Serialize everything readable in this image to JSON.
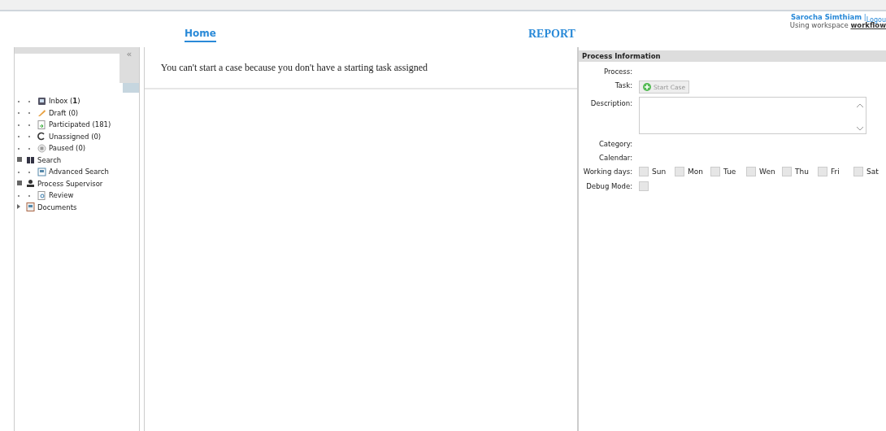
{
  "nav": {
    "tabs": [
      {
        "label": "Home",
        "selected": true
      },
      {
        "label": "REPORT",
        "selected": false
      }
    ]
  },
  "user": {
    "name": "Sarocha Simthiam",
    "separator": "|",
    "logout": "Logou",
    "workspace_label": "Using workspace",
    "workspace": "workflow"
  },
  "sidebar": {
    "collapse": "«",
    "tree": [
      {
        "label": "Inbox (**1**)"
      },
      {
        "label": "Draft (0)"
      },
      {
        "label": "Participated (181)"
      },
      {
        "label": "Unassigned (0)"
      },
      {
        "label": "Paused (0)"
      },
      {
        "label": "Search",
        "expanded": true,
        "children": [
          {
            "label": "Advanced Search"
          }
        ]
      },
      {
        "label": "Process Supervisor",
        "expanded": true,
        "children": [
          {
            "label": "Review"
          }
        ]
      },
      {
        "label": "Documents",
        "expanded": false
      }
    ]
  },
  "main": {
    "message": "You can't start a case because you don't have a starting task assigned"
  },
  "process_info": {
    "title": "Process Information",
    "fields": [
      {
        "kind": "text",
        "label": "Process:"
      },
      {
        "kind": "button",
        "label": "Task:",
        "button": "Start Case",
        "disabled": true
      },
      {
        "kind": "textarea",
        "label": "Description:"
      },
      {
        "kind": "text",
        "label": "Category:"
      },
      {
        "kind": "text",
        "label": "Calendar:"
      },
      {
        "kind": "days",
        "label": "Working days:",
        "days": [
          {
            "label": "Sun",
            "checked": false
          },
          {
            "label": "Mon",
            "checked": false
          },
          {
            "label": "Tue",
            "checked": false
          },
          {
            "label": "Wen",
            "checked": false
          },
          {
            "label": "Thu",
            "checked": false
          },
          {
            "label": "Fri",
            "checked": false
          },
          {
            "label": "Sat",
            "checked": false
          }
        ]
      },
      {
        "kind": "check",
        "label": "Debug Mode:",
        "checked": false
      }
    ]
  }
}
